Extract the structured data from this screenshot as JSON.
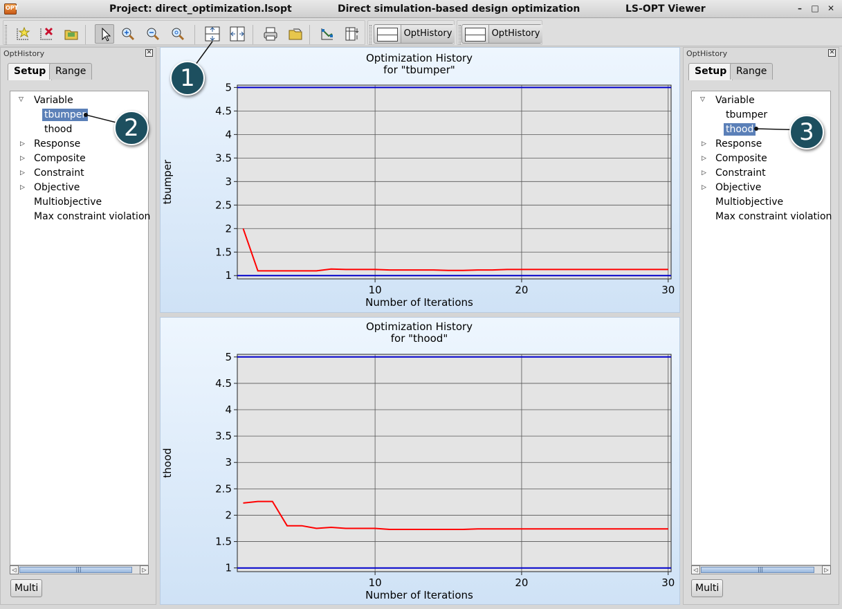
{
  "window": {
    "project": "Project: direct_optimization.lsopt",
    "subtitle": "Direct simulation-based design optimization",
    "app": "LS-OPT Viewer",
    "btn_minimize": "–",
    "btn_maximize": "□",
    "btn_close": "✕",
    "icon_text": "OPT"
  },
  "toolbar": {
    "icons": [
      "new-plot-icon",
      "delete-plot-icon",
      "open-folder-icon",
      "pointer-icon",
      "zoom-in-icon",
      "zoom-out-icon",
      "zoom-fit-icon",
      "split-horizontal-icon",
      "split-vertical-icon",
      "print-icon",
      "export-icon",
      "graph-settings-icon",
      "table-settings-icon"
    ],
    "opt_button_1": "OptHistory",
    "opt_button_2": "OptHistory"
  },
  "left_panel": {
    "title": "OptHistory",
    "tabs": [
      "Setup",
      "Range"
    ],
    "tree": [
      {
        "label": "Variable",
        "expanded": true
      },
      {
        "label": "tbumper",
        "child": true,
        "selected": true
      },
      {
        "label": "thood",
        "child": true,
        "selected": false
      },
      {
        "label": "Response",
        "expanded": false
      },
      {
        "label": "Composite",
        "expanded": false
      },
      {
        "label": "Constraint",
        "expanded": false
      },
      {
        "label": "Objective",
        "expanded": false
      },
      {
        "label": "Multiobjective"
      },
      {
        "label": "Max constraint violation"
      }
    ],
    "multi_button": "Multi"
  },
  "right_panel": {
    "title": "OptHistory",
    "tabs": [
      "Setup",
      "Range"
    ],
    "tree": [
      {
        "label": "Variable",
        "expanded": true
      },
      {
        "label": "tbumper",
        "child": true,
        "selected": false
      },
      {
        "label": "thood",
        "child": true,
        "selected": true
      },
      {
        "label": "Response",
        "expanded": false
      },
      {
        "label": "Composite",
        "expanded": false
      },
      {
        "label": "Constraint",
        "expanded": false
      },
      {
        "label": "Objective",
        "expanded": false
      },
      {
        "label": "Multiobjective"
      },
      {
        "label": "Max constraint violation"
      }
    ],
    "multi_button": "Multi"
  },
  "callouts": [
    "1",
    "2",
    "3"
  ],
  "colors": {
    "history_line": "#ff0000",
    "bound_line": "#0000cc",
    "plot_background": "#e4e4e4",
    "selection": "#5b80b8",
    "callout": "#1d4f5f"
  },
  "chart_data": [
    {
      "type": "line",
      "title": "Optimization History",
      "subtitle": "for \"tbumper\"",
      "xlabel": "Number of Iterations",
      "ylabel": "tbumper",
      "xlim": [
        0.6,
        30.2
      ],
      "ylim": [
        0.93,
        5.05
      ],
      "xticks": [
        10,
        20,
        30
      ],
      "yticks": [
        1,
        1.5,
        2,
        2.5,
        3,
        3.5,
        4,
        4.5,
        5
      ],
      "grid": true,
      "series": [
        {
          "role": "history",
          "x": [
            1,
            2,
            3,
            4,
            5,
            6,
            7,
            8,
            9,
            10,
            11,
            12,
            13,
            14,
            15,
            16,
            17,
            18,
            19,
            20,
            21,
            22,
            23,
            24,
            25,
            26,
            27,
            28,
            29,
            30
          ],
          "values": [
            2.0,
            1.1,
            1.1,
            1.1,
            1.1,
            1.1,
            1.14,
            1.13,
            1.13,
            1.13,
            1.12,
            1.12,
            1.12,
            1.12,
            1.11,
            1.11,
            1.12,
            1.12,
            1.13,
            1.13,
            1.13,
            1.13,
            1.13,
            1.13,
            1.13,
            1.13,
            1.13,
            1.13,
            1.13,
            1.13
          ]
        },
        {
          "role": "upper-bound",
          "x": [
            0.6,
            30.2
          ],
          "values": [
            5,
            5
          ]
        },
        {
          "role": "lower-bound",
          "x": [
            0.6,
            30.2
          ],
          "values": [
            1,
            1
          ]
        }
      ]
    },
    {
      "type": "line",
      "title": "Optimization History",
      "subtitle": "for \"thood\"",
      "xlabel": "Number of Iterations",
      "ylabel": "thood",
      "xlim": [
        0.6,
        30.2
      ],
      "ylim": [
        0.93,
        5.05
      ],
      "xticks": [
        10,
        20,
        30
      ],
      "yticks": [
        1,
        1.5,
        2,
        2.5,
        3,
        3.5,
        4,
        4.5,
        5
      ],
      "grid": true,
      "series": [
        {
          "role": "history",
          "x": [
            1,
            2,
            3,
            4,
            5,
            6,
            7,
            8,
            9,
            10,
            11,
            12,
            13,
            14,
            15,
            16,
            17,
            18,
            19,
            20,
            21,
            22,
            23,
            24,
            25,
            26,
            27,
            28,
            29,
            30
          ],
          "values": [
            2.23,
            2.26,
            2.26,
            1.8,
            1.8,
            1.75,
            1.77,
            1.75,
            1.75,
            1.75,
            1.73,
            1.73,
            1.73,
            1.73,
            1.73,
            1.73,
            1.74,
            1.74,
            1.74,
            1.74,
            1.74,
            1.74,
            1.74,
            1.74,
            1.74,
            1.74,
            1.74,
            1.74,
            1.74,
            1.74
          ]
        },
        {
          "role": "upper-bound",
          "x": [
            0.6,
            30.2
          ],
          "values": [
            5,
            5
          ]
        },
        {
          "role": "lower-bound",
          "x": [
            0.6,
            30.2
          ],
          "values": [
            1,
            1
          ]
        }
      ]
    }
  ]
}
